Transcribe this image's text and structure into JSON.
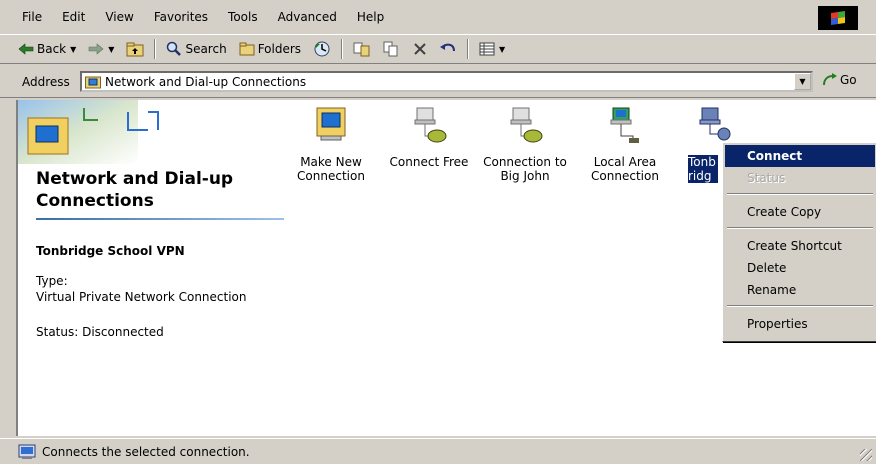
{
  "menu": [
    "File",
    "Edit",
    "View",
    "Favorites",
    "Tools",
    "Advanced",
    "Help"
  ],
  "toolbar": {
    "back_label": "Back",
    "search_label": "Search",
    "folders_label": "Folders"
  },
  "address": {
    "label": "Address",
    "value": "Network and Dial-up Connections",
    "go_label": "Go"
  },
  "left_pane": {
    "title": "Network and Dial-up Connections",
    "selected_name": "Tonbridge School VPN",
    "type_label": "Type:",
    "type_value": "Virtual Private Network Connection",
    "status": "Status: Disconnected"
  },
  "connections": [
    {
      "label": "Make New Connection",
      "icon": "make-new-connection-icon"
    },
    {
      "label": "Connect Free",
      "icon": "dialup-connection-icon"
    },
    {
      "label": "Connection to Big John",
      "icon": "dialup-connection-icon"
    },
    {
      "label": "Local Area Connection",
      "icon": "lan-connection-icon"
    },
    {
      "label": "Tonbridge School",
      "icon": "vpn-connection-icon"
    }
  ],
  "context_menu": {
    "connect": "Connect",
    "status": "Status",
    "create_copy": "Create Copy",
    "create_shortcut": "Create Shortcut",
    "delete": "Delete",
    "rename": "Rename",
    "properties": "Properties"
  },
  "statusbar": {
    "text": "Connects the selected connection."
  },
  "colors": {
    "chrome": "#d4d0c8",
    "selection": "#0a246a",
    "accent": "#3a6ea5"
  }
}
